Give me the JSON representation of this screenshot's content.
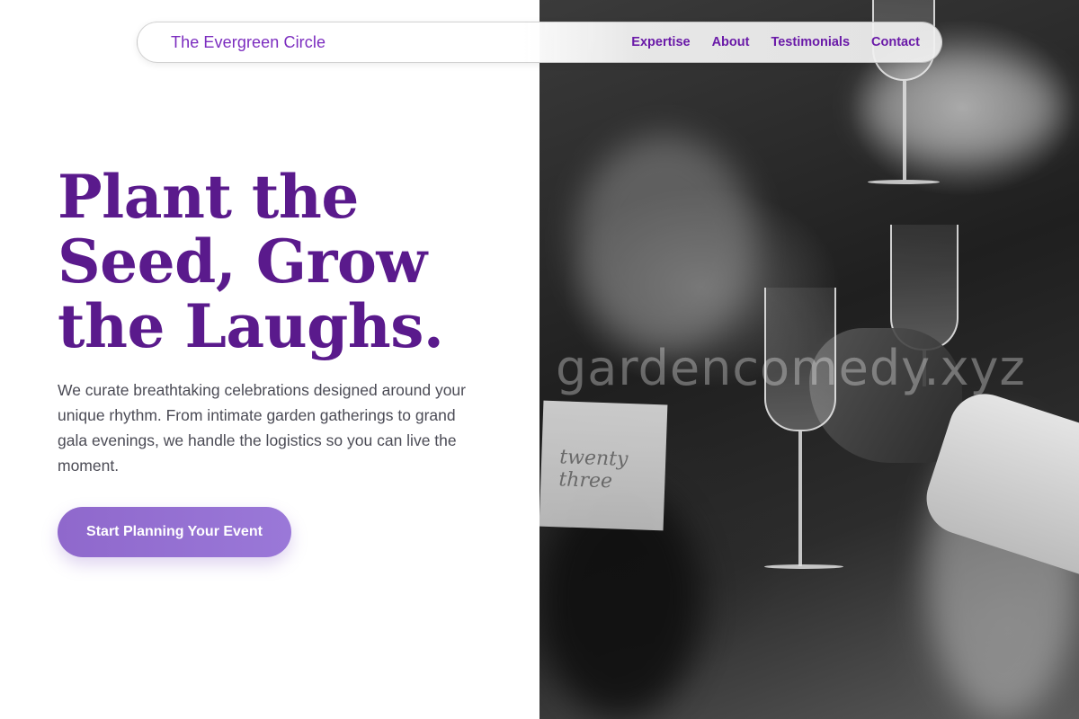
{
  "nav": {
    "brand": "The Evergreen Circle",
    "links": [
      "Expertise",
      "About",
      "Testimonials",
      "Contact"
    ]
  },
  "hero": {
    "headline_lines": [
      "Plant the",
      "Seed, Grow",
      "the Laughs."
    ],
    "lead": "We curate breathtaking celebrations designed around your unique rhythm. From intimate garden gatherings to grand gala evenings, we handle the logistics so you can live the moment.",
    "cta_label": "Start Planning Your Event"
  },
  "photo": {
    "watermark": "gardencomedy.xyz",
    "card_text": "twenty three"
  },
  "colors": {
    "brand_purple": "#7b2cbf",
    "headline_purple": "#5a1a8c",
    "cta_start": "#8f68cc",
    "cta_end": "#9a78d8"
  }
}
